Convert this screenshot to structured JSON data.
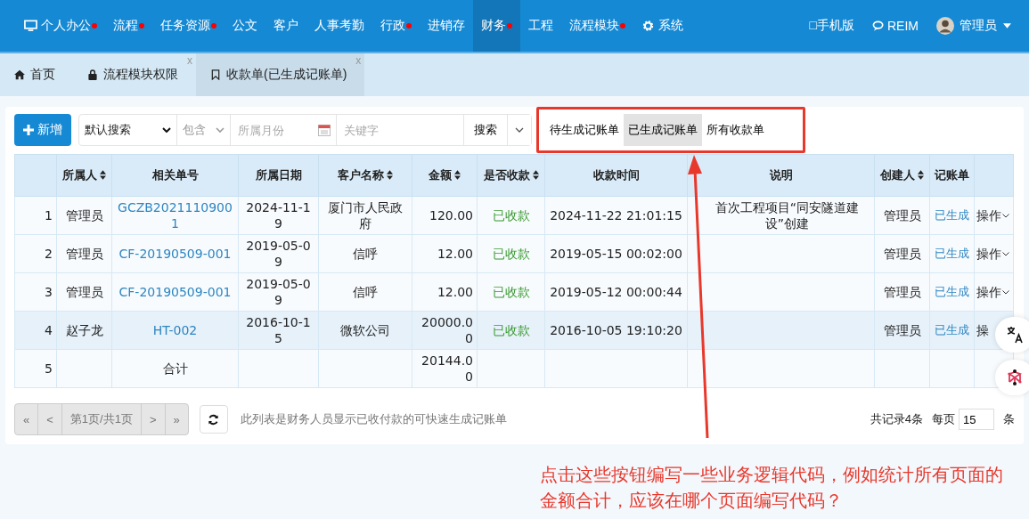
{
  "nav": {
    "items": [
      {
        "label": "个人办公",
        "dot": true,
        "selected": false
      },
      {
        "label": "流程",
        "dot": true,
        "selected": false
      },
      {
        "label": "任务资源",
        "dot": true,
        "selected": false
      },
      {
        "label": "公文",
        "dot": false,
        "selected": false
      },
      {
        "label": "客户",
        "dot": false,
        "selected": false
      },
      {
        "label": "人事考勤",
        "dot": false,
        "selected": false
      },
      {
        "label": "行政",
        "dot": true,
        "selected": false
      },
      {
        "label": "进销存",
        "dot": false,
        "selected": false
      },
      {
        "label": "财务",
        "dot": true,
        "selected": true
      },
      {
        "label": "工程",
        "dot": false,
        "selected": false
      },
      {
        "label": "流程模块",
        "dot": true,
        "selected": false
      },
      {
        "label": "系统",
        "dot": false,
        "selected": false
      }
    ],
    "mobile": "□手机版",
    "reim": "REIM",
    "user": "管理员"
  },
  "tabs": [
    {
      "label": "首页",
      "selected": false
    },
    {
      "label": "流程模块权限",
      "close": "x",
      "selected": false
    },
    {
      "label": "收款单(已生成记账单)",
      "close": "x",
      "selected": true
    }
  ],
  "toolbar": {
    "add": "新增",
    "search_type": "默认搜索",
    "match": "包含",
    "month": {
      "placeholder": "所属月份"
    },
    "keyword": {
      "placeholder": "关键字"
    },
    "search": "搜索",
    "filters": [
      {
        "label": "待生成记账单",
        "selected": false
      },
      {
        "label": "已生成记账单",
        "selected": true
      },
      {
        "label": "所有收款单",
        "selected": false
      }
    ]
  },
  "table": {
    "columns": [
      {
        "sort": false
      },
      {
        "label": "所属人",
        "sort": true
      },
      {
        "label": "相关单号",
        "sort": false
      },
      {
        "label": "所属日期",
        "sort": false
      },
      {
        "label": "客户名称",
        "sort": true
      },
      {
        "label": "金额",
        "sort": true
      },
      {
        "label": "是否收款",
        "sort": true
      },
      {
        "label": "收款时间",
        "sort": false
      },
      {
        "label": "说明",
        "sort": false
      },
      {
        "label": "创建人",
        "sort": true
      },
      {
        "label": "记账单",
        "sort": false
      },
      {
        "sort": false
      }
    ],
    "rows": [
      {
        "kind": "record",
        "selected": false,
        "no": "1",
        "owner": "管理员",
        "ref": "GCZB20211109001",
        "date": "2024-11-19",
        "customer": "厦门市人民政府",
        "amount": "120.00",
        "status": "已收款",
        "time": "2024-11-22 21:01:15",
        "note": "首次工程项目“同安隧道建设”创建",
        "creator": "管理员",
        "ledger": "已生成",
        "op": "操作",
        "op_caret": true
      },
      {
        "kind": "record",
        "selected": false,
        "no": "2",
        "owner": "管理员",
        "ref": "CF-20190509-001",
        "date": "2019-05-09",
        "customer": "信呼",
        "amount": "12.00",
        "status": "已收款",
        "time": "2019-05-15 00:02:00",
        "creator": "管理员",
        "ledger": "已生成",
        "op": "操作",
        "op_caret": true
      },
      {
        "kind": "record",
        "selected": false,
        "no": "3",
        "owner": "管理员",
        "ref": "CF-20190509-001",
        "date": "2019-05-09",
        "customer": "信呼",
        "amount": "12.00",
        "status": "已收款",
        "time": "2019-05-12 00:00:44",
        "creator": "管理员",
        "ledger": "已生成",
        "op": "操作",
        "op_caret": true
      },
      {
        "kind": "record",
        "selected": true,
        "no": "4",
        "owner": "赵子龙",
        "ref": "HT-002",
        "date": "2016-10-15",
        "customer": "微软公司",
        "amount": "20000.00",
        "status": "已收款",
        "time": "2016-10-05 19:10:20",
        "creator": "管理员",
        "ledger": "已生成",
        "op": "操",
        "op_caret": false
      },
      {
        "kind": "total",
        "selected": false,
        "no": "5",
        "label": "合计",
        "amount": "20144.00"
      }
    ]
  },
  "pager": {
    "first": "«",
    "prev": "<",
    "page": "第1页/共1页",
    "next": ">",
    "last": "»",
    "note": "此列表是财务人员显示已收付款的可快速生成记账单",
    "total": "共记录4条",
    "per_page": "每页",
    "size": "15",
    "unit": "条"
  },
  "annotation": "点击这些按钮编写一些业务逻辑代码，例如统计所有页面的金额合计，应该在哪个页面编写代码？"
}
